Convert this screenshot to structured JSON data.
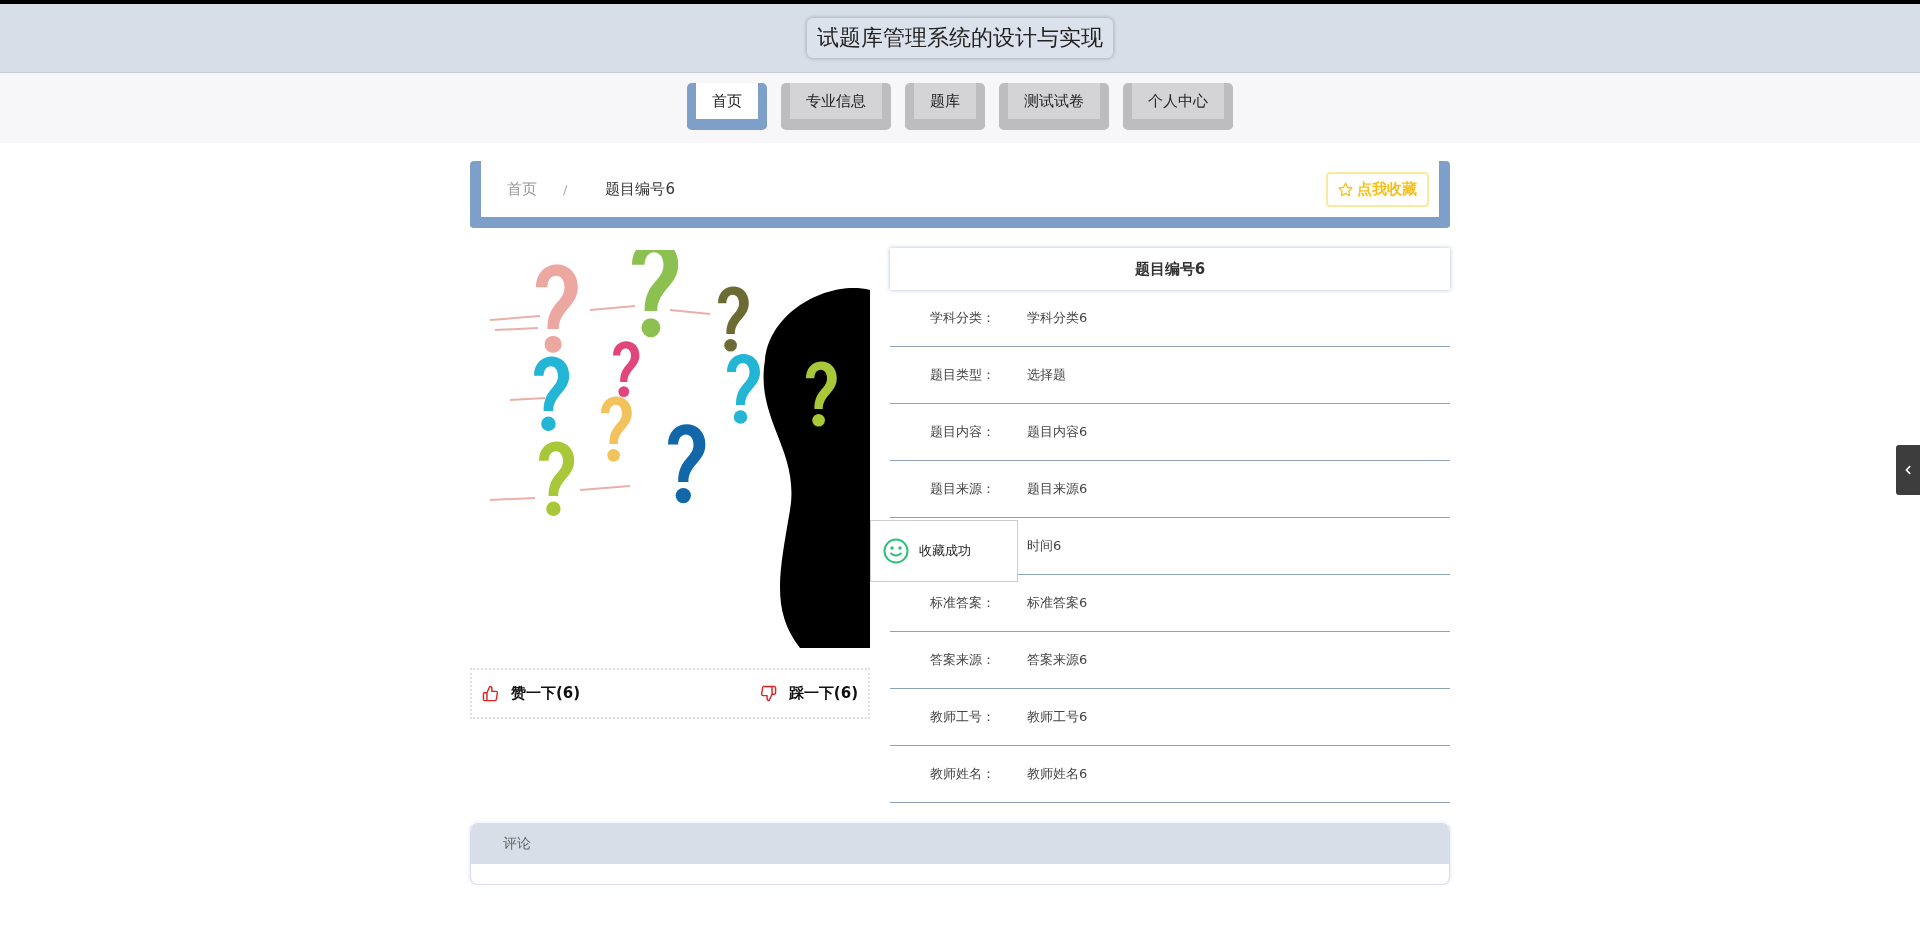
{
  "header": {
    "title": "试题库管理系统的设计与实现"
  },
  "nav": [
    {
      "label": "首页",
      "selected": true
    },
    {
      "label": "专业信息",
      "selected": false
    },
    {
      "label": "题库",
      "selected": false
    },
    {
      "label": "测试试卷",
      "selected": false
    },
    {
      "label": "个人中心",
      "selected": false
    }
  ],
  "breadcrumb": {
    "items": [
      "首页",
      "题目编号6"
    ],
    "separator": "/",
    "favorite_button": "点我收藏"
  },
  "votes": {
    "like": "赞一下(6)",
    "dislike": "踩一下(6)"
  },
  "detail": {
    "title": "题目编号6",
    "rows": [
      {
        "label": "学科分类：",
        "value": "学科分类6"
      },
      {
        "label": "题目类型：",
        "value": "选择题"
      },
      {
        "label": "题目内容：",
        "value": "题目内容6"
      },
      {
        "label": "题目来源：",
        "value": "题目来源6"
      },
      {
        "value": "时间6"
      },
      {
        "label": "标准答案：",
        "value": "标准答案6"
      },
      {
        "label": "答案来源：",
        "value": "答案来源6"
      },
      {
        "label": "教师工号：",
        "value": "教师工号6"
      },
      {
        "label": "教师姓名：",
        "value": "教师姓名6"
      }
    ]
  },
  "toast": {
    "message": "收藏成功"
  },
  "comments": {
    "title": "评论"
  }
}
